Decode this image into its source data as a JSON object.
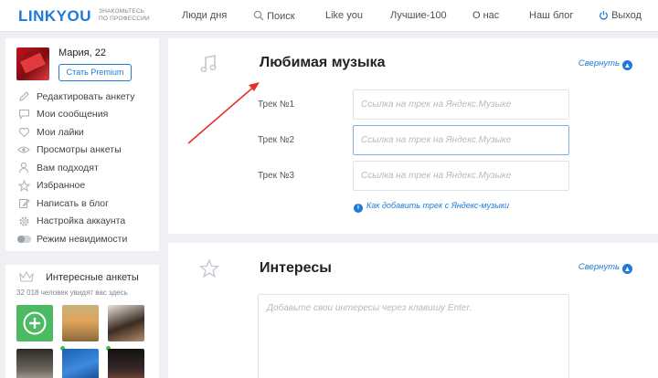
{
  "header": {
    "logo": "LINKYOU",
    "tagline_line1": "ЗНАКОМЬТЕСЬ",
    "tagline_line2": "ПО ПРОФЕССИИ",
    "nav": {
      "people_of_day": "Люди дня",
      "search": "Поиск",
      "like_you": "Like you",
      "best100": "Лучшие-100",
      "about": "О нас",
      "blog": "Наш блог",
      "logout": "Выход"
    }
  },
  "profile": {
    "name": "Мария, 22",
    "premium_button": "Стать Premium",
    "menu": [
      {
        "label": "Редактировать анкету",
        "icon": "pencil-icon"
      },
      {
        "label": "Мои сообщения",
        "icon": "message-icon"
      },
      {
        "label": "Мои лайки",
        "icon": "heart-icon"
      },
      {
        "label": "Просмотры анкеты",
        "icon": "eye-icon"
      },
      {
        "label": "Вам подходят",
        "icon": "user-icon"
      },
      {
        "label": "Избранное",
        "icon": "star-icon"
      },
      {
        "label": "Написать в блог",
        "icon": "edit-icon"
      },
      {
        "label": "Настройка аккаунта",
        "icon": "gear-icon"
      },
      {
        "label": "Режим невидимости",
        "icon": "toggle-icon"
      }
    ]
  },
  "interesting": {
    "title": "Интересные анкеты",
    "subtitle": "32 018 человек увидят вас здесь"
  },
  "music": {
    "title": "Любимая музыка",
    "collapse": "Свернуть",
    "tracks": [
      {
        "label": "Трек №1",
        "placeholder": "Ссылка на трек на Яндекс.Музыке"
      },
      {
        "label": "Трек №2",
        "placeholder": "Ссылка на трек на Яндекс.Музыке"
      },
      {
        "label": "Трек №3",
        "placeholder": "Ссылка на трек на Яндекс.Музыке"
      }
    ],
    "help_link": "Как добавить трек с Яндекс-музыки"
  },
  "interests": {
    "title": "Интересы",
    "collapse": "Свернуть",
    "placeholder": "Добавьте свои интересы через клавишу Enter."
  },
  "colors": {
    "accent": "#1d7ad9",
    "annotation_arrow": "#e8302a",
    "online_dot": "#3cc14e"
  }
}
